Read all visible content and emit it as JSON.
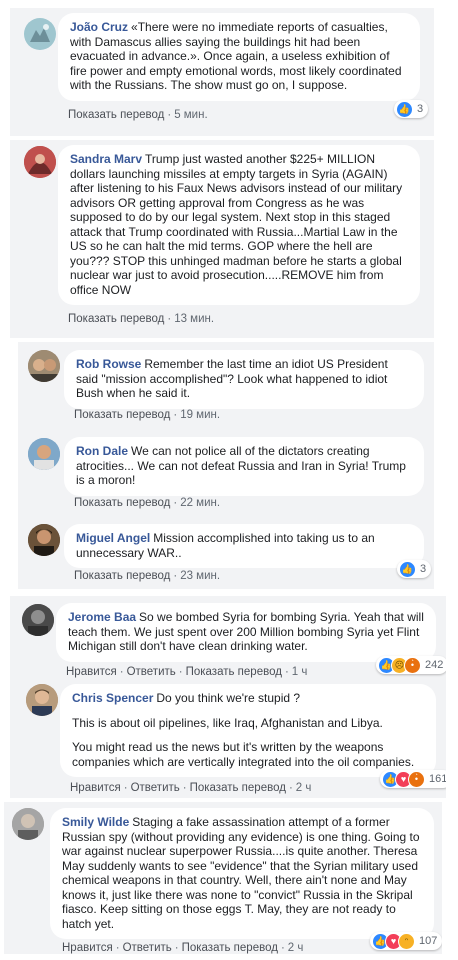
{
  "labels": {
    "translate": "Показать перевод",
    "like": "Нравится",
    "reply": "Ответить"
  },
  "comments": [
    {
      "author": "João Cruz",
      "paragraphs": [
        "«There were no immediate reports of casualties, with Damascus allies saying the buildings hit had been evacuated in advance.». Once again, a useless exhibition of fire power and empty emotional words, most likely coordinated with the Russians. The show must go on, I suppose."
      ],
      "time": "5 мин.",
      "reactions": [
        "like-icon"
      ],
      "reaction_count": "3"
    },
    {
      "author": "Sandra Marv",
      "paragraphs": [
        "Trump just wasted another $225+ MILLION dollars launching missiles at empty targets in Syria (AGAIN) after listening to his Faux News advisors instead of our military advisors OR getting approval from Congress as he was supposed to do by our legal system. Next stop in this staged attack that Trump coordinated with Russia...Martial Law in the US so he can halt the mid terms. GOP where the hell are you??? STOP this unhinged madman before he starts a global nuclear war just to avoid prosecution.....REMOVE him from office NOW"
      ],
      "time": "13 мин."
    },
    {
      "author": "Rob Rowse",
      "paragraphs": [
        "Remember the last time an idiot US President said \"mission accomplished\"? Look what happened to idiot Bush when he said it."
      ],
      "time": "19 мин."
    },
    {
      "author": "Ron Dale",
      "paragraphs": [
        "We can not police all of the dictators creating atrocities... We can not defeat Russia and Iran in Syria! Trump is a moron!"
      ],
      "time": "22 мин."
    },
    {
      "author": "Miguel Angel",
      "paragraphs": [
        "Mission accomplished into taking us to an unnecessary WAR.."
      ],
      "time": "23 мин.",
      "reactions": [
        "like-icon"
      ],
      "reaction_count": "3"
    },
    {
      "author": "Jerome Baa",
      "paragraphs": [
        "So we bombed Syria for bombing Syria. Yeah that will teach them. We just spent over 200 Million bombing Syria yet Flint Michigan still don't have clean drinking water."
      ],
      "time": "1 ч",
      "reactions": [
        "like-icon",
        "sad-icon",
        "angry-icon"
      ],
      "reaction_count": "242"
    },
    {
      "author": "Chris Spencer",
      "paragraphs": [
        "Do you think we're stupid ?",
        "This is about oil pipelines, like Iraq, Afghanistan and Libya.",
        "You might read us the news but it's written by the weapons companies which are vertically integrated into the oil companies."
      ],
      "time": "2 ч",
      "reactions": [
        "like-icon",
        "love-icon",
        "angry-icon"
      ],
      "reaction_count": "161"
    },
    {
      "author": "Smily Wilde",
      "paragraphs": [
        "Staging a fake assassination attempt of a former Russian spy (without providing any evidence) is one thing. Going to war against nuclear superpower Russia....is quite another. Theresa May suddenly wants to see \"evidence\" that the Syrian military used chemical weapons in that country. Well, there ain't none and May knows it, just like there was none to \"convict\" Russia in the Skripal fiasco. Keep sitting on those eggs T. May, they are not ready to hatch yet."
      ],
      "time": "2 ч",
      "reactions": [
        "like-icon",
        "love-icon",
        "haha-icon"
      ],
      "reaction_count": "107"
    }
  ]
}
